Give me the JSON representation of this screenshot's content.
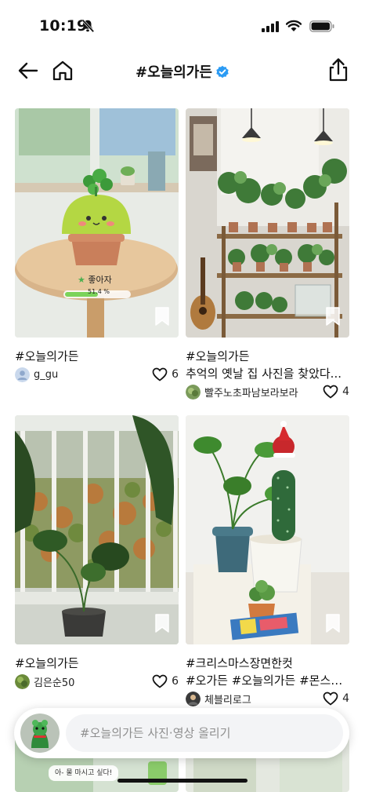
{
  "status": {
    "time": "10:19"
  },
  "header": {
    "title": "#오늘의가든"
  },
  "posts": [
    {
      "tag": "#오늘의가든",
      "caption": "",
      "author": "g_gu",
      "likes": "6",
      "overlay_name": "좋아자",
      "overlay_progress": "51.4 %",
      "progress_value": 0.514
    },
    {
      "tag": "#오늘의가든",
      "caption": "추억의 옛날 집 사진을 찾았다...",
      "author": "빨주노초파남보라보라",
      "likes": "4"
    },
    {
      "tag": "#오늘의가든",
      "caption": "",
      "author": "김은순50",
      "likes": "6"
    },
    {
      "tag": "#크리스마스장면한컷",
      "caption": "#오가든 #오늘의가든 #몬스테...",
      "author": "체블리로그",
      "likes": "4"
    }
  ],
  "composer": {
    "placeholder": "#오늘의가든 사진·영상 올리기"
  },
  "peek": {
    "bubble": "아- 물 마시고 싶다!"
  },
  "colors": {
    "accent_blue": "#2b9bf4",
    "progress_green": "#7bd35a"
  }
}
